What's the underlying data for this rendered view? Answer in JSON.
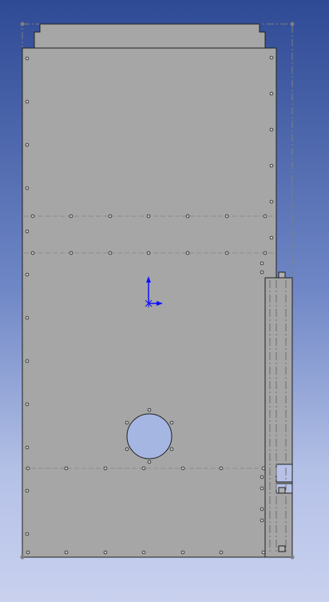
{
  "viewport": {
    "background_top": "#2f4a95",
    "background_bottom": "#c9d1ef"
  },
  "part": {
    "fill": "#a6a6a6",
    "edge_color": "#202020",
    "hole_fill": "#a6b6e2"
  },
  "sketch": {
    "line_color": "#7f7f7f",
    "point_color": "#707070"
  },
  "origin": {
    "icon": "coordinate-axes-icon",
    "color": "#1010ff"
  }
}
